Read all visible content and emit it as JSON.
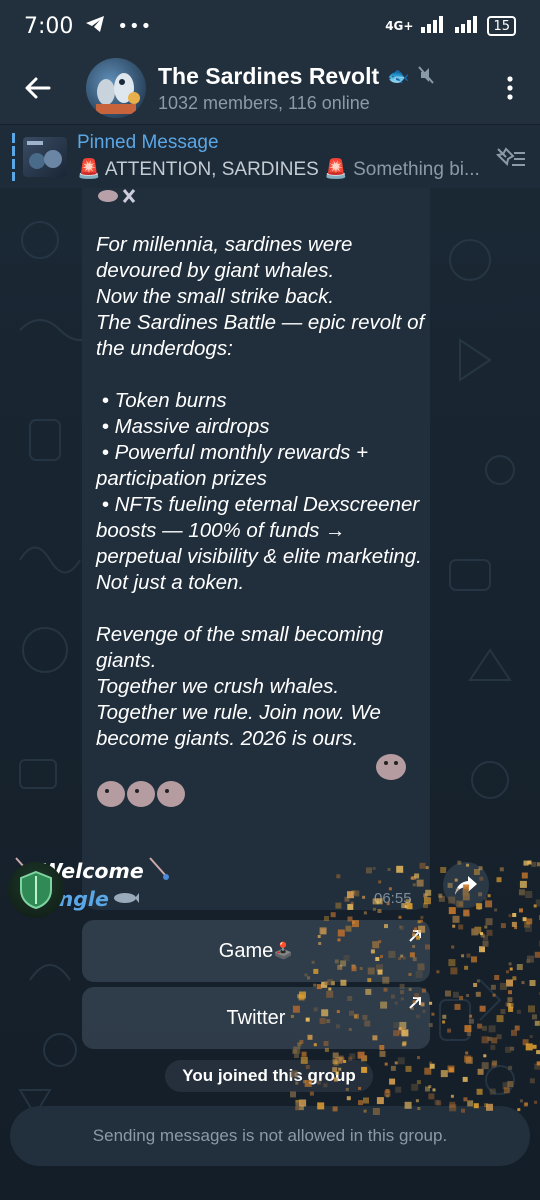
{
  "status_bar": {
    "time": "7:00",
    "network": "4G+",
    "battery": "15"
  },
  "header": {
    "title": "The Sardines Revolt",
    "title_emoji": "🐟",
    "subtitle": "1032 members, 116 online"
  },
  "pinned": {
    "title": "Pinned Message",
    "emoji": "🚨",
    "text": "ATTENTION, SARDINES",
    "preview": "Something bi..."
  },
  "message": {
    "body": "For millennia, sardines were devoured by giant whales.\nNow the small strike back.\nThe Sardines Battle — epic revolt of the underdogs:\n\n • Token burns\n • Massive airdrops\n • Powerful monthly rewards + participation prizes\n • NFTs fueling eternal Dexscreener boosts — 100% of funds → perpetual visibility & elite marketing.\nNot just a token.\n\nRevenge of the small becoming giants.\nTogether we crush whales.\nTogether we rule. Join now. We become giants. 2026 is ours.",
    "welcome": "Welcome",
    "jingle": "Jingle",
    "time": "06:55"
  },
  "inline_buttons": {
    "game": "Game",
    "game_emoji": "🕹️",
    "twitter": "Twitter"
  },
  "service_message": "You joined this group",
  "bottom_bar": "Sending messages is not allowed in this group.",
  "colors": {
    "accent": "#5ba7e6",
    "bubble": "#212e3b",
    "header": "#22303d"
  }
}
